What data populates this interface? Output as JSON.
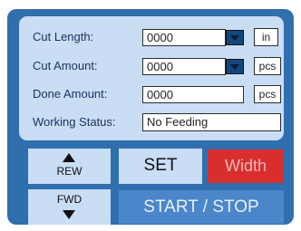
{
  "status": {
    "cut_length": {
      "label": "Cut Length:",
      "value": "0000",
      "unit": "in"
    },
    "cut_amount": {
      "label": "Cut Amount:",
      "value": "0000",
      "unit": "pcs"
    },
    "done_amount": {
      "label": "Done Amount:",
      "value": "0000",
      "unit": "pcs"
    },
    "working_status": {
      "label": "Working Status:",
      "value": "No Feeding"
    }
  },
  "controls": {
    "rew_label": "REW",
    "fwd_label": "FWD",
    "set_label": "SET",
    "width_label": "Width",
    "start_stop_label": "START / STOP"
  },
  "colors": {
    "panel": "#2f6fae",
    "status_box": "#c9ddf5",
    "dropdown": "#14467c",
    "width_button": "#d92e2e",
    "start_stop_button": "#4a86c9"
  },
  "icons": {
    "rew": "arrow-up-icon",
    "fwd": "arrow-down-icon",
    "dropdown": "chevron-down-icon"
  }
}
